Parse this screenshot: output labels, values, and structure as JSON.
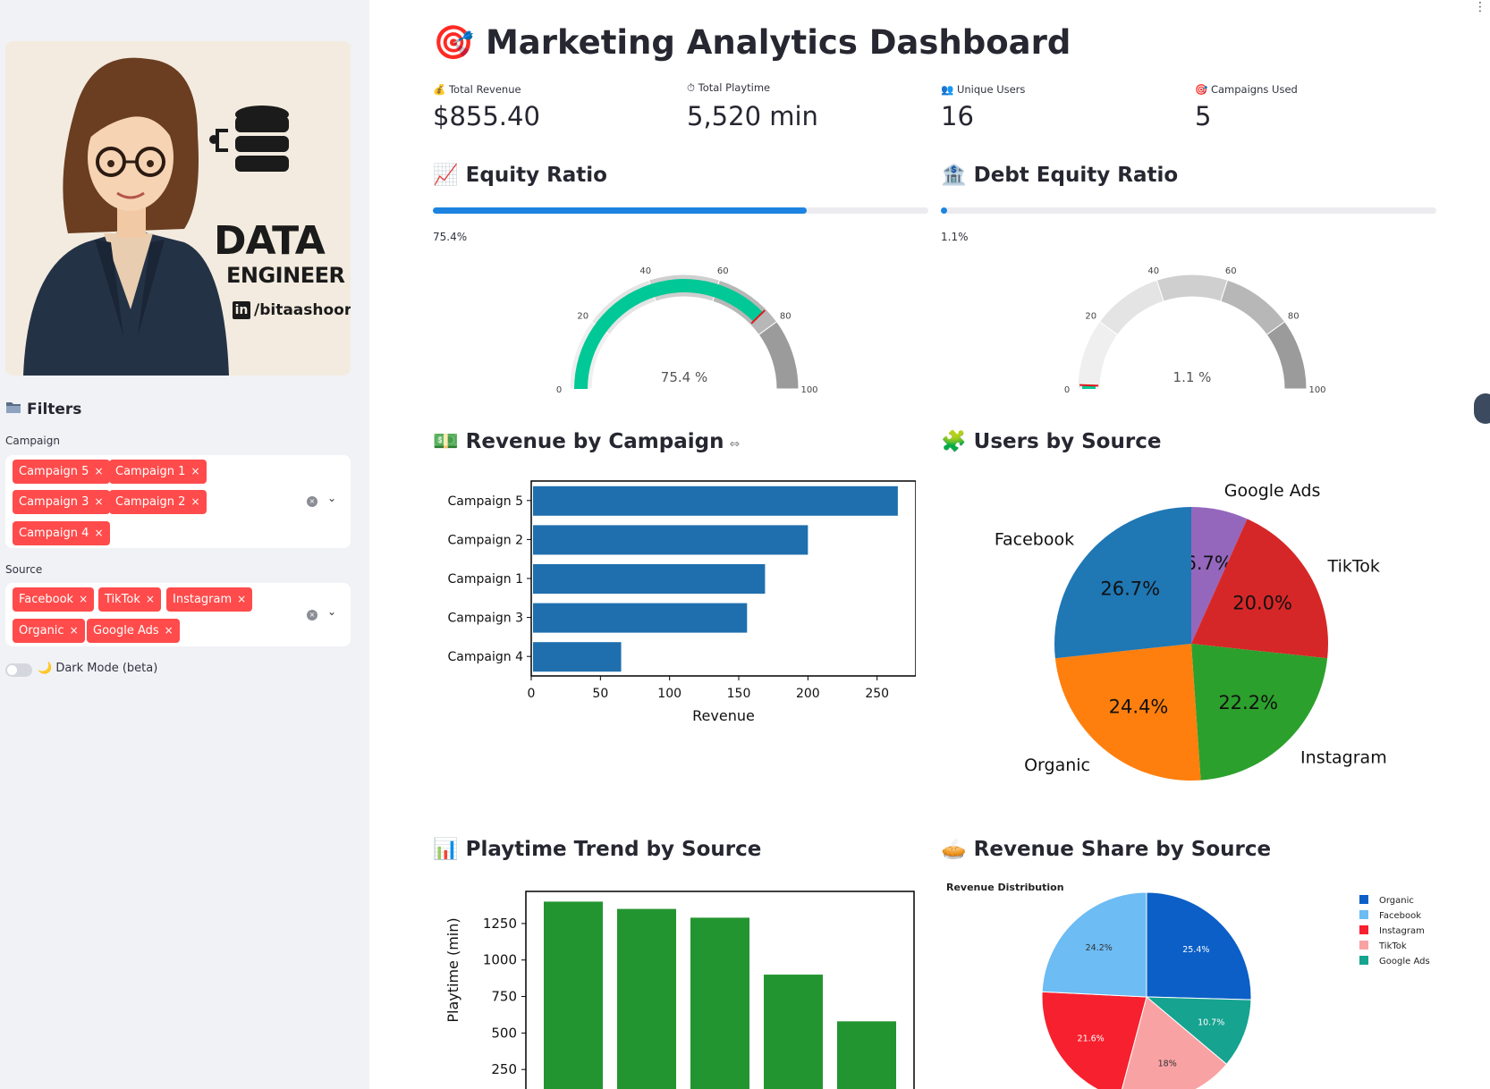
{
  "sidebar": {
    "banner": {
      "title": "DATA",
      "subtitle": "ENGINEER",
      "li_glyph": "in",
      "handle": "/bitaashoori"
    },
    "filters_title": "Filters",
    "campaign": {
      "label": "Campaign",
      "tags": [
        "Campaign 5",
        "Campaign 1",
        "Campaign 3",
        "Campaign 2",
        "Campaign 4"
      ]
    },
    "source": {
      "label": "Source",
      "tags": [
        "Facebook",
        "TikTok",
        "Instagram",
        "Organic",
        "Google Ads"
      ]
    },
    "dark_mode": {
      "label": "🌙 Dark Mode (beta)",
      "on": false
    },
    "tag_remove": "×",
    "clear": "×",
    "chevron": "⌄"
  },
  "main": {
    "title": "🎯 Marketing Analytics Dashboard",
    "metrics": [
      {
        "label": "💰 Total Revenue",
        "value": "$855.40"
      },
      {
        "label": "⏱ Total Playtime",
        "value": "5,520 min"
      },
      {
        "label": "👥 Unique Users",
        "value": "16"
      },
      {
        "label": "🎯 Campaigns Used",
        "value": "5"
      }
    ],
    "equity": {
      "title": "📈 Equity Ratio",
      "progress": 0.754,
      "progress_text": "75.4%",
      "gauge_text": "75.4 %"
    },
    "debt": {
      "title": "🏦 Debt Equity Ratio",
      "progress": 0.011,
      "progress_text": "1.1%",
      "gauge_text": "1.1 %"
    },
    "revenue_campaign_title": "💵 Revenue by Campaign",
    "users_source_title": "🧩 Users by Source",
    "playtime_title": "📊 Playtime Trend by Source",
    "revenue_share_title": "🥧 Revenue Share by Source",
    "link_icon": "⇔"
  },
  "colors": {
    "accent": "#ff4b4b",
    "progress": "#1c83e1",
    "gauge_green": "#00c896",
    "bar_blue": "#1f6fae",
    "bar_green": "#239530"
  },
  "chart_data": [
    {
      "type": "gauge",
      "id": "equity_gauge",
      "value": 75.4,
      "range": [
        0,
        100
      ],
      "ticks": [
        "0",
        "20",
        "40",
        "60",
        "80",
        "100"
      ],
      "value_text": "75.4 %"
    },
    {
      "type": "gauge",
      "id": "debt_gauge",
      "value": 1.1,
      "range": [
        0,
        100
      ],
      "ticks": [
        "0",
        "20",
        "40",
        "60",
        "80",
        "100"
      ],
      "value_text": "1.1 %"
    },
    {
      "type": "bar",
      "id": "revenue_by_campaign",
      "orientation": "horizontal",
      "categories": [
        "Campaign 5",
        "Campaign 2",
        "Campaign 1",
        "Campaign 3",
        "Campaign 4"
      ],
      "values": [
        265,
        200,
        169,
        156,
        65
      ],
      "xlabel": "Revenue",
      "xticks": [
        0,
        50,
        100,
        150,
        200,
        250
      ],
      "xlim": [
        0,
        278
      ]
    },
    {
      "type": "pie",
      "id": "users_by_source",
      "labels": [
        "Google Ads",
        "TikTok",
        "Instagram",
        "Organic",
        "Facebook"
      ],
      "values": [
        6.7,
        20.0,
        22.2,
        24.4,
        26.7
      ],
      "value_labels": [
        "6.7%",
        "20.0%",
        "22.2%",
        "24.4%",
        "26.7%"
      ],
      "colors": [
        "#9467bd",
        "#d62728",
        "#2ca02c",
        "#ff7f0e",
        "#1f77b4"
      ]
    },
    {
      "type": "bar",
      "id": "playtime_trend",
      "values": [
        1400,
        1350,
        1290,
        900,
        580
      ],
      "ylabel": "Playtime (min)",
      "yticks": [
        250,
        500,
        750,
        1000,
        1250
      ],
      "ylim": [
        0,
        1470
      ]
    },
    {
      "type": "pie",
      "id": "revenue_share",
      "title": "Revenue Distribution",
      "labels": [
        "Organic",
        "Facebook",
        "Instagram",
        "TikTok",
        "Google Ads"
      ],
      "values": [
        25.4,
        24.2,
        21.6,
        18,
        10.7
      ],
      "value_labels": [
        "25.4%",
        "24.2%",
        "21.6%",
        "18%",
        "10.7%"
      ],
      "colors": [
        "#0b5fc7",
        "#6dbcf4",
        "#f7202e",
        "#f9a2a4",
        "#16a390"
      ],
      "legend": "right"
    }
  ]
}
